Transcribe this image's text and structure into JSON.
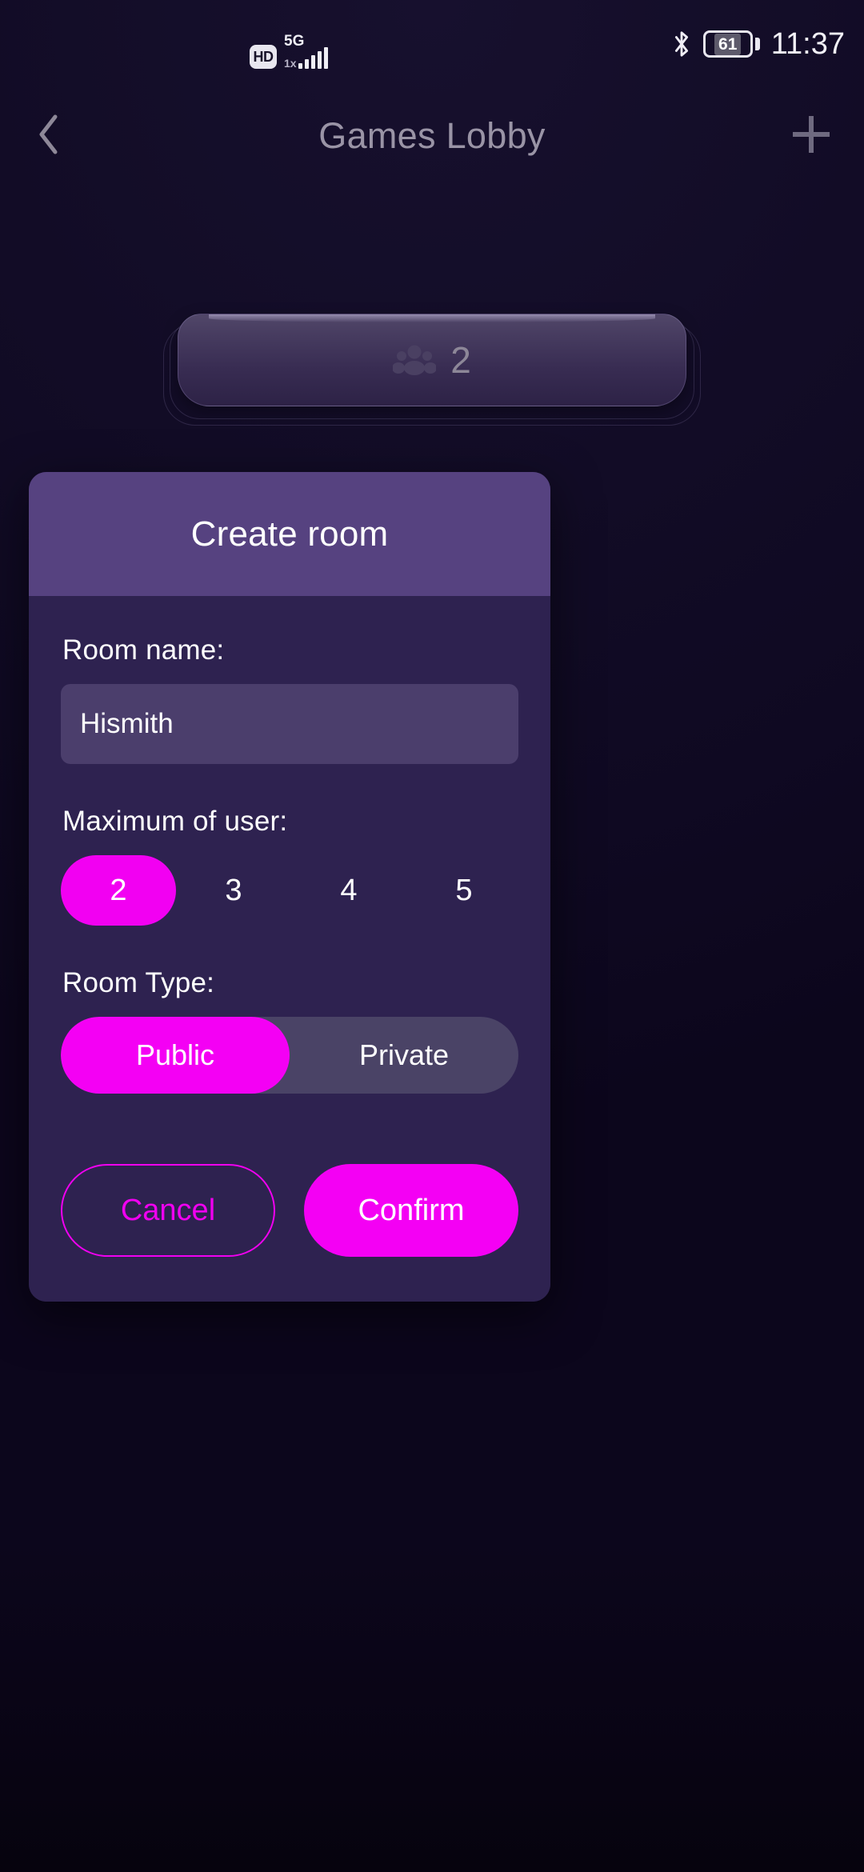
{
  "status_bar": {
    "hd_label": "HD",
    "network_gen": "5G",
    "network_sub": "1x",
    "signal_bars": 5,
    "bluetooth_icon": "bluetooth-icon",
    "battery_level": "61",
    "time": "11:37"
  },
  "header": {
    "back_icon": "chevron-left-icon",
    "title": "Games Lobby",
    "add_icon": "plus-icon"
  },
  "room_card": {
    "people_icon": "people-group-icon",
    "count": "2"
  },
  "dialog": {
    "title": "Create room",
    "room_name": {
      "label": "Room name:",
      "value": "Hismith",
      "placeholder": "Room name"
    },
    "max_users": {
      "label": "Maximum of user:",
      "options": [
        "2",
        "3",
        "4",
        "5"
      ],
      "selected": "2"
    },
    "room_type": {
      "label": "Room Type:",
      "options": [
        "Public",
        "Private"
      ],
      "selected": "Public"
    },
    "buttons": {
      "cancel": "Cancel",
      "confirm": "Confirm"
    }
  },
  "colors": {
    "accent": "#f400f4",
    "dialog_body": "#2e2250",
    "dialog_header": "#564280",
    "input_bg": "#4b3e6c",
    "segment_track": "#4a4366",
    "page_bg": "#120c26",
    "title_muted": "#9a94a6"
  }
}
